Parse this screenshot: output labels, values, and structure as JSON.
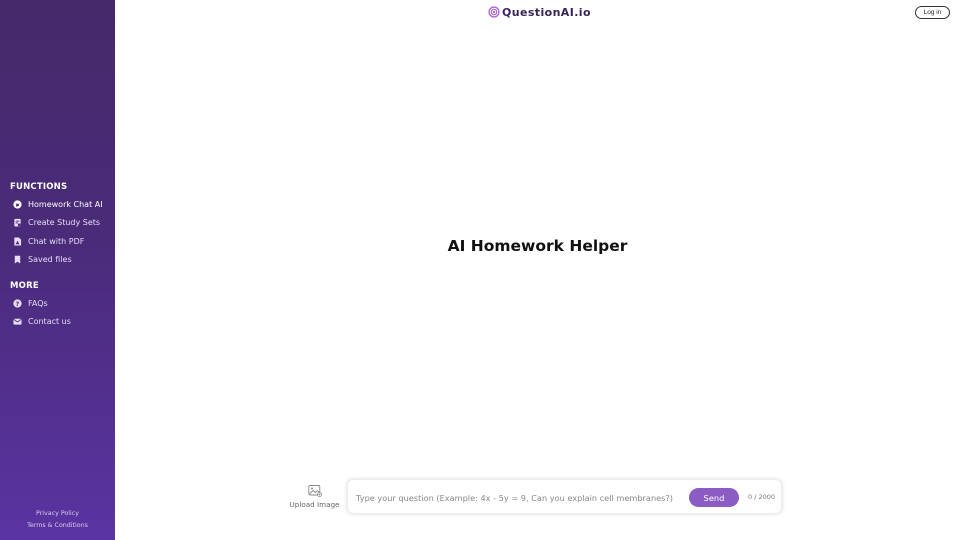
{
  "header": {
    "logo_text": "QuestionAI.io",
    "login_label": "Log in"
  },
  "sidebar": {
    "sections": [
      {
        "title": "FUNCTIONS",
        "items": [
          {
            "label": "Homework Chat AI",
            "icon": "chat-bubble-icon",
            "active": true
          },
          {
            "label": "Create Study Sets",
            "icon": "study-sets-icon",
            "active": false
          },
          {
            "label": "Chat with PDF",
            "icon": "pdf-file-icon",
            "active": false
          },
          {
            "label": "Saved files",
            "icon": "bookmark-icon",
            "active": false
          }
        ]
      },
      {
        "title": "MORE",
        "items": [
          {
            "label": "FAQs",
            "icon": "question-circle-icon",
            "active": false
          },
          {
            "label": "Contact us",
            "icon": "envelope-icon",
            "active": false
          }
        ]
      }
    ],
    "footer": {
      "privacy_label": "Privacy Policy",
      "terms_label": "Terms & Conditions"
    }
  },
  "main": {
    "title": "AI Homework Helper"
  },
  "composer": {
    "upload_label": "Upload Image",
    "input_value": "",
    "input_placeholder": "Type your question (Example: 4x - 5y = 9, Can you explain cell membranes?)",
    "send_label": "Send",
    "char_count": "0 / 2000"
  },
  "colors": {
    "sidebar_top": "#46296a",
    "sidebar_bottom": "#5a34a2",
    "accent": "#8a5cc4",
    "logo_text": "#3b2358"
  }
}
